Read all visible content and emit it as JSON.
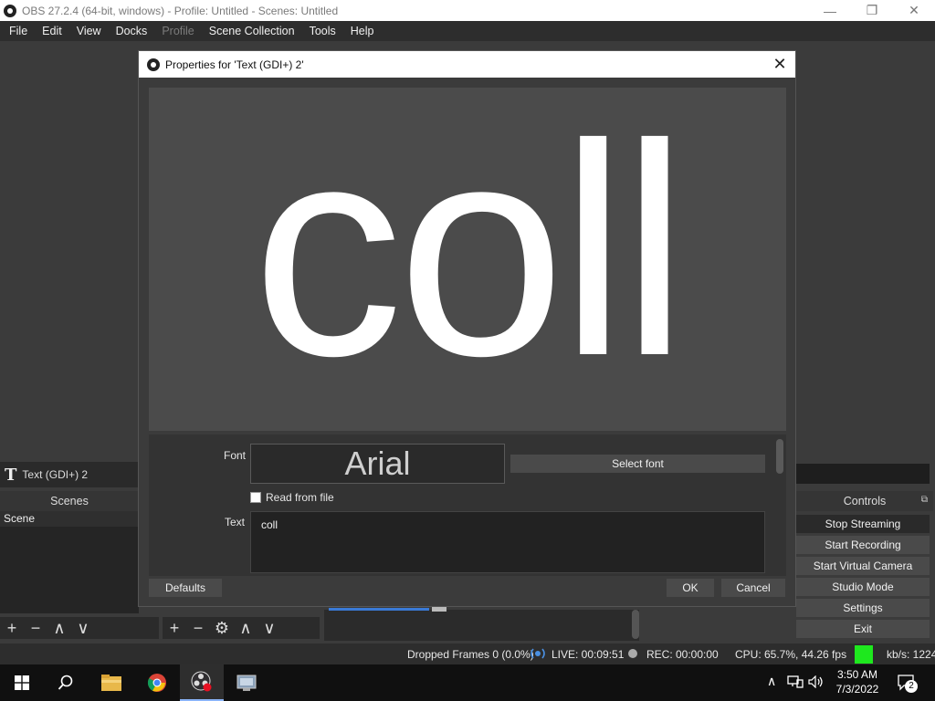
{
  "window": {
    "title": "OBS 27.2.4 (64-bit, windows) - Profile: Untitled - Scenes: Untitled",
    "minimize": "—",
    "maximize": "❐",
    "close": "✕"
  },
  "menu": {
    "items": [
      "File",
      "Edit",
      "View",
      "Docks",
      "Profile",
      "Scene Collection",
      "Tools",
      "Help"
    ],
    "disabled": [
      "Profile"
    ]
  },
  "source": {
    "icon_glyph": "T",
    "name": "Text (GDI+) 2"
  },
  "scenes": {
    "header": "Scenes",
    "items": [
      "Scene"
    ]
  },
  "controls": {
    "header": "Controls",
    "buttons": [
      "Stop Streaming",
      "Start Recording",
      "Start Virtual Camera",
      "Studio Mode",
      "Settings",
      "Exit"
    ]
  },
  "toolbar": {
    "add": "+",
    "remove": "−",
    "settings": "⚙",
    "up": "∧",
    "down": "∨"
  },
  "status": {
    "dropped_frames": "Dropped Frames 0 (0.0%)",
    "live": "LIVE: 00:09:51",
    "rec": "REC: 00:00:00",
    "cpu": "CPU: 65.7%, 44.26 fps",
    "kbs": "kb/s: 1224",
    "health_color": "#1ee81e"
  },
  "dialog": {
    "title": "Properties for 'Text (GDI+) 2'",
    "close": "✕",
    "preview_text": "coll",
    "font_label": "Font",
    "font_value": "Arial",
    "select_font": "Select font",
    "read_from_file": "Read from file",
    "text_label": "Text",
    "text_value": "coll",
    "defaults": "Defaults",
    "ok": "OK",
    "cancel": "Cancel"
  },
  "taskbar": {
    "time": "3:50 AM",
    "date": "7/3/2022",
    "notifications": "2"
  }
}
